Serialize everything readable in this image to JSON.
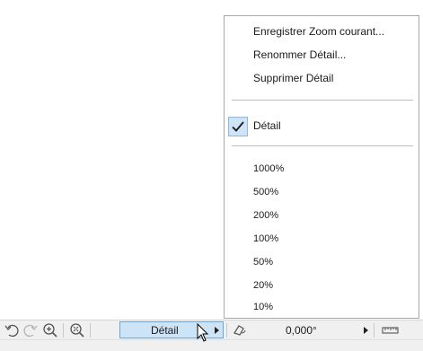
{
  "menu": {
    "items": [
      {
        "label": "Enregistrer Zoom courant..."
      },
      {
        "label": "Renommer Détail..."
      },
      {
        "label": "Supprimer Détail"
      }
    ],
    "checked_item": {
      "label": "Détail",
      "checked": true
    },
    "zoom_levels": [
      "1000%",
      "500%",
      "200%",
      "100%",
      "50%",
      "20%",
      "10%"
    ]
  },
  "toolbar": {
    "icons": [
      "undo-view-icon",
      "redo-view-icon",
      "zoom-in-icon",
      "fit-in-window-icon",
      "orientation-icon",
      "measure-icon"
    ],
    "detail_button_label": "Détail",
    "angle_value": "0,000°"
  },
  "colors": {
    "menu_border": "#a8a8a8",
    "highlight_bg": "#cde4f7",
    "highlight_border": "#6aa6d8",
    "toolbar_bg": "#f0f0f0"
  }
}
